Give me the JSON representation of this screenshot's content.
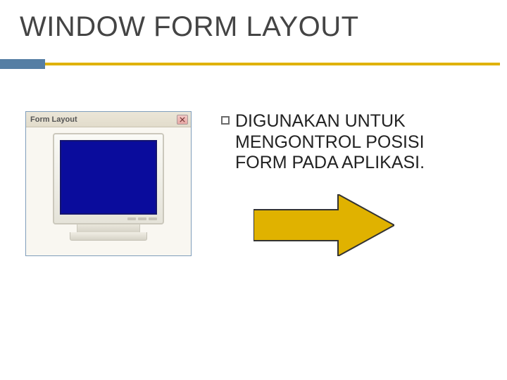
{
  "title": "WINDOW FORM LAYOUT",
  "form_window": {
    "titlebar_label": "Form Layout"
  },
  "bullet": {
    "text": "DIGUNAKAN UNTUK MENGONTROL POSISI FORM PADA APLIKASI."
  },
  "colors": {
    "title_bar_accent": "#557ea4",
    "underline": "#e0b200",
    "monitor_screen": "#0a0c9c",
    "arrow_fill": "#e0b200",
    "arrow_stroke": "#333333"
  }
}
